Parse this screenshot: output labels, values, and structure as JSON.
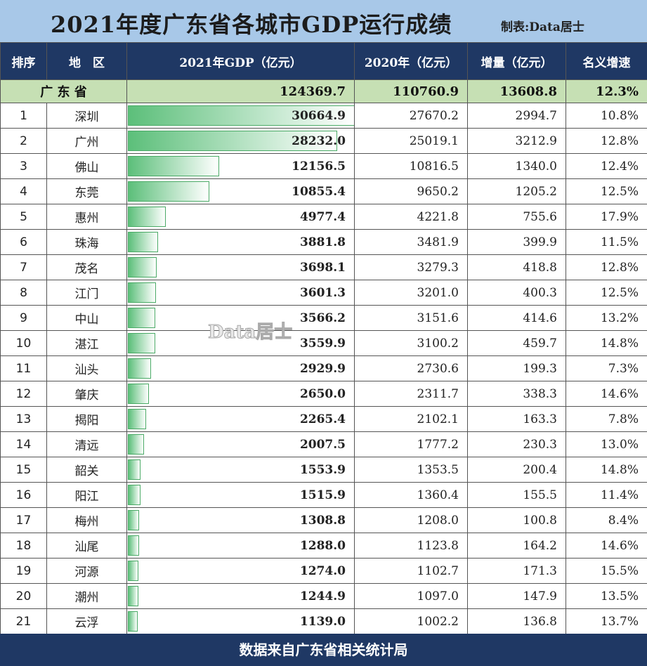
{
  "title": "2021年度广东省各城市GDP运行成绩",
  "maker": "制表:Data居士",
  "columns": [
    "排序",
    "地　区",
    "2021年GDP（亿元）",
    "2020年（亿元）",
    "增量（亿元）",
    "名义增速"
  ],
  "province": {
    "name": "广 东 省",
    "gdp2021": "124369.7",
    "gdp2020": "110760.9",
    "increase": "13608.8",
    "growth": "12.3%"
  },
  "cities": [
    {
      "rank": "1",
      "name": "深圳",
      "gdp2021": "30664.9",
      "gdp2020": "27670.2",
      "increase": "2994.7",
      "growth": "10.8%"
    },
    {
      "rank": "2",
      "name": "广州",
      "gdp2021": "28232.0",
      "gdp2020": "25019.1",
      "increase": "3212.9",
      "growth": "12.8%"
    },
    {
      "rank": "3",
      "name": "佛山",
      "gdp2021": "12156.5",
      "gdp2020": "10816.5",
      "increase": "1340.0",
      "growth": "12.4%"
    },
    {
      "rank": "4",
      "name": "东莞",
      "gdp2021": "10855.4",
      "gdp2020": "9650.2",
      "increase": "1205.2",
      "growth": "12.5%"
    },
    {
      "rank": "5",
      "name": "惠州",
      "gdp2021": "4977.4",
      "gdp2020": "4221.8",
      "increase": "755.6",
      "growth": "17.9%"
    },
    {
      "rank": "6",
      "name": "珠海",
      "gdp2021": "3881.8",
      "gdp2020": "3481.9",
      "increase": "399.9",
      "growth": "11.5%"
    },
    {
      "rank": "7",
      "name": "茂名",
      "gdp2021": "3698.1",
      "gdp2020": "3279.3",
      "increase": "418.8",
      "growth": "12.8%"
    },
    {
      "rank": "8",
      "name": "江门",
      "gdp2021": "3601.3",
      "gdp2020": "3201.0",
      "increase": "400.3",
      "growth": "12.5%"
    },
    {
      "rank": "9",
      "name": "中山",
      "gdp2021": "3566.2",
      "gdp2020": "3151.6",
      "increase": "414.6",
      "growth": "13.2%"
    },
    {
      "rank": "10",
      "name": "湛江",
      "gdp2021": "3559.9",
      "gdp2020": "3100.2",
      "increase": "459.7",
      "growth": "14.8%"
    },
    {
      "rank": "11",
      "name": "汕头",
      "gdp2021": "2929.9",
      "gdp2020": "2730.6",
      "increase": "199.3",
      "growth": "7.3%"
    },
    {
      "rank": "12",
      "name": "肇庆",
      "gdp2021": "2650.0",
      "gdp2020": "2311.7",
      "increase": "338.3",
      "growth": "14.6%"
    },
    {
      "rank": "13",
      "name": "揭阳",
      "gdp2021": "2265.4",
      "gdp2020": "2102.1",
      "increase": "163.3",
      "growth": "7.8%"
    },
    {
      "rank": "14",
      "name": "清远",
      "gdp2021": "2007.5",
      "gdp2020": "1777.2",
      "increase": "230.3",
      "growth": "13.0%"
    },
    {
      "rank": "15",
      "name": "韶关",
      "gdp2021": "1553.9",
      "gdp2020": "1353.5",
      "increase": "200.4",
      "growth": "14.8%"
    },
    {
      "rank": "16",
      "name": "阳江",
      "gdp2021": "1515.9",
      "gdp2020": "1360.4",
      "increase": "155.5",
      "growth": "11.4%"
    },
    {
      "rank": "17",
      "name": "梅州",
      "gdp2021": "1308.8",
      "gdp2020": "1208.0",
      "increase": "100.8",
      "growth": "8.4%"
    },
    {
      "rank": "18",
      "name": "汕尾",
      "gdp2021": "1288.0",
      "gdp2020": "1123.8",
      "increase": "164.2",
      "growth": "14.6%"
    },
    {
      "rank": "19",
      "name": "河源",
      "gdp2021": "1274.0",
      "gdp2020": "1102.7",
      "increase": "171.3",
      "growth": "15.5%"
    },
    {
      "rank": "20",
      "name": "潮州",
      "gdp2021": "1244.9",
      "gdp2020": "1097.0",
      "increase": "147.9",
      "growth": "13.5%"
    },
    {
      "rank": "21",
      "name": "云浮",
      "gdp2021": "1139.0",
      "gdp2020": "1002.2",
      "increase": "136.8",
      "growth": "13.7%"
    }
  ],
  "watermark": "Data居士",
  "footer": "数据来自广东省相关统计局",
  "colors": {
    "header_bg": "#1f3864",
    "title_bg": "#a8c8e8",
    "province_bg": "#c6e0b4",
    "bar": "#5cbf7a"
  }
}
